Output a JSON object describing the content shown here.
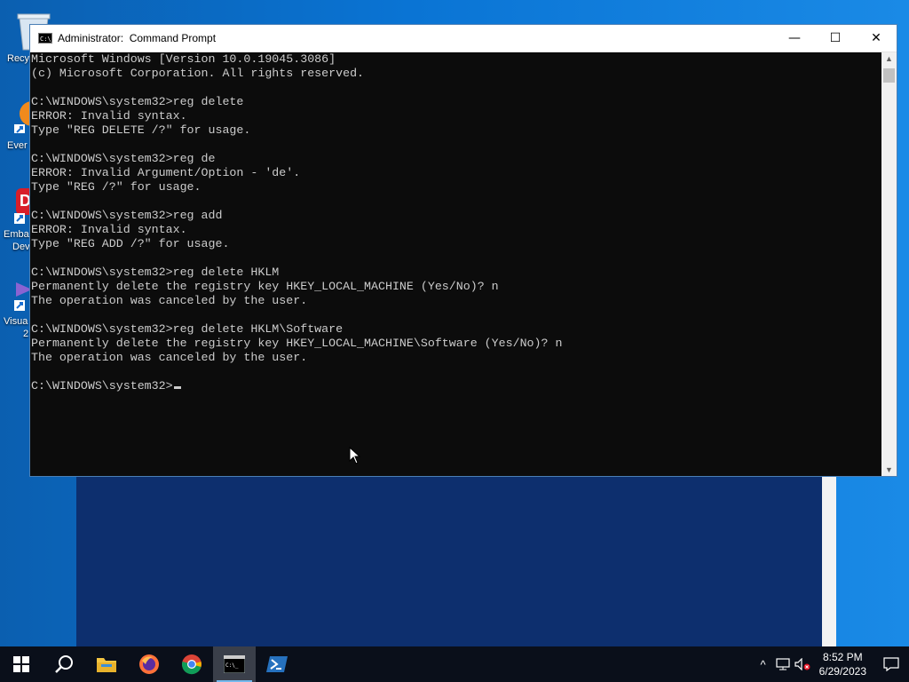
{
  "desktop": {
    "icons": [
      {
        "label": "Recy",
        "name": "recycle-bin-icon"
      },
      {
        "label": "Ever",
        "name": "everything-icon"
      },
      {
        "label": "Emba",
        "label2": "Dev",
        "name": "embarcadero-dev-icon"
      },
      {
        "label": "Visua",
        "label2": "2",
        "name": "visual-studio-icon"
      }
    ]
  },
  "window": {
    "title": "Administrator:  Command Prompt",
    "icon_text": "C:\\_",
    "minimize_glyph": "—",
    "maximize_glyph": "☐",
    "close_glyph": "✕"
  },
  "console": {
    "lines": [
      "Microsoft Windows [Version 10.0.19045.3086]",
      "(c) Microsoft Corporation. All rights reserved.",
      "",
      "C:\\WINDOWS\\system32>reg delete",
      "ERROR: Invalid syntax.",
      "Type \"REG DELETE /?\" for usage.",
      "",
      "C:\\WINDOWS\\system32>reg de",
      "ERROR: Invalid Argument/Option - 'de'.",
      "Type \"REG /?\" for usage.",
      "",
      "C:\\WINDOWS\\system32>reg add",
      "ERROR: Invalid syntax.",
      "Type \"REG ADD /?\" for usage.",
      "",
      "C:\\WINDOWS\\system32>reg delete HKLM",
      "Permanently delete the registry key HKEY_LOCAL_MACHINE (Yes/No)? n",
      "The operation was canceled by the user.",
      "",
      "C:\\WINDOWS\\system32>reg delete HKLM\\Software",
      "Permanently delete the registry key HKEY_LOCAL_MACHINE\\Software (Yes/No)? n",
      "The operation was canceled by the user.",
      ""
    ],
    "prompt": "C:\\WINDOWS\\system32>",
    "scroll_up": "▲",
    "scroll_down": "▼"
  },
  "taskbar": {
    "items": [
      {
        "name": "start-button"
      },
      {
        "name": "search-button"
      },
      {
        "name": "file-explorer-button"
      },
      {
        "name": "firefox-button"
      },
      {
        "name": "chrome-button"
      },
      {
        "name": "command-prompt-button",
        "active": true
      },
      {
        "name": "powershell-button"
      }
    ],
    "tray": {
      "chevron": "^",
      "time": "8:52 PM",
      "date": "6/29/2023"
    }
  },
  "colors": {
    "console_bg": "#0c0c0c",
    "console_fg": "#cccccc",
    "taskbar_bg": "#0a0f1a",
    "desktop_accent": "#0a74d4"
  }
}
